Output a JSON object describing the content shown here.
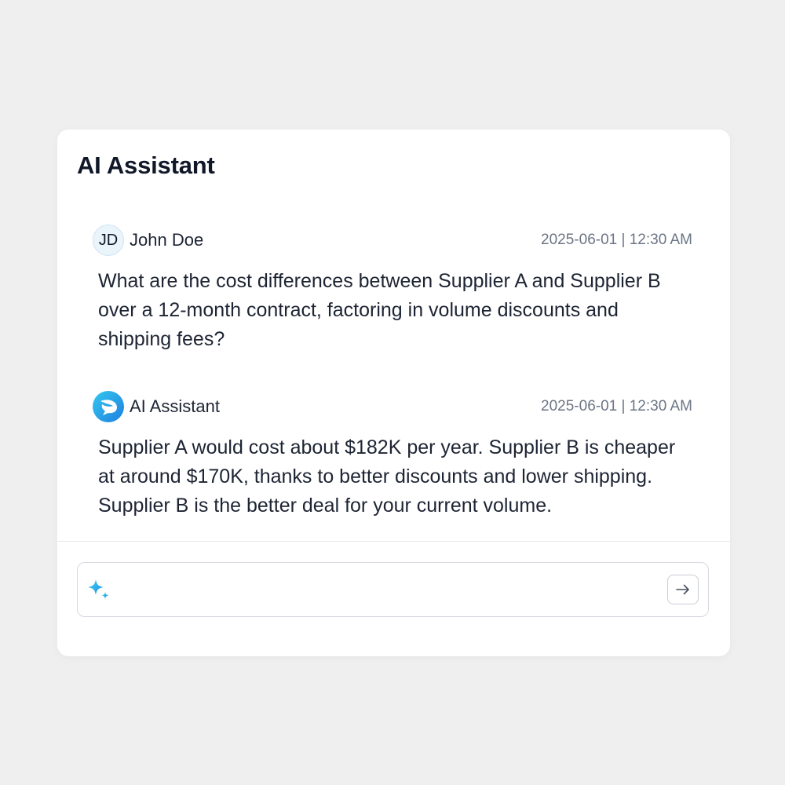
{
  "panel": {
    "title": "AI Assistant"
  },
  "messages": [
    {
      "avatar_initials": "JD",
      "sender": "John Doe",
      "timestamp": "2025-06-01 | 12:30 AM",
      "text": "What are the cost differences between Supplier A and Supplier B over a 12-month contract, factoring in volume discounts and shipping fees?"
    },
    {
      "avatar_icon": "assistant-logo-icon",
      "sender": "AI Assistant",
      "timestamp": "2025-06-01 | 12:30 AM",
      "text": "Supplier A would cost about $182K per year. Supplier B is cheaper at around $170K, thanks to better discounts and lower shipping. Supplier B is the better deal for your current volume."
    }
  ],
  "composer": {
    "value": "",
    "leading_icon": "sparkle-icon",
    "send_icon": "arrow-right-icon"
  },
  "colors": {
    "background": "#efeff0",
    "card": "#ffffff",
    "accent_cyan": "#33c8ef",
    "accent_blue": "#1f7fe0",
    "text_primary": "#101828",
    "text_secondary": "#6b7585"
  }
}
